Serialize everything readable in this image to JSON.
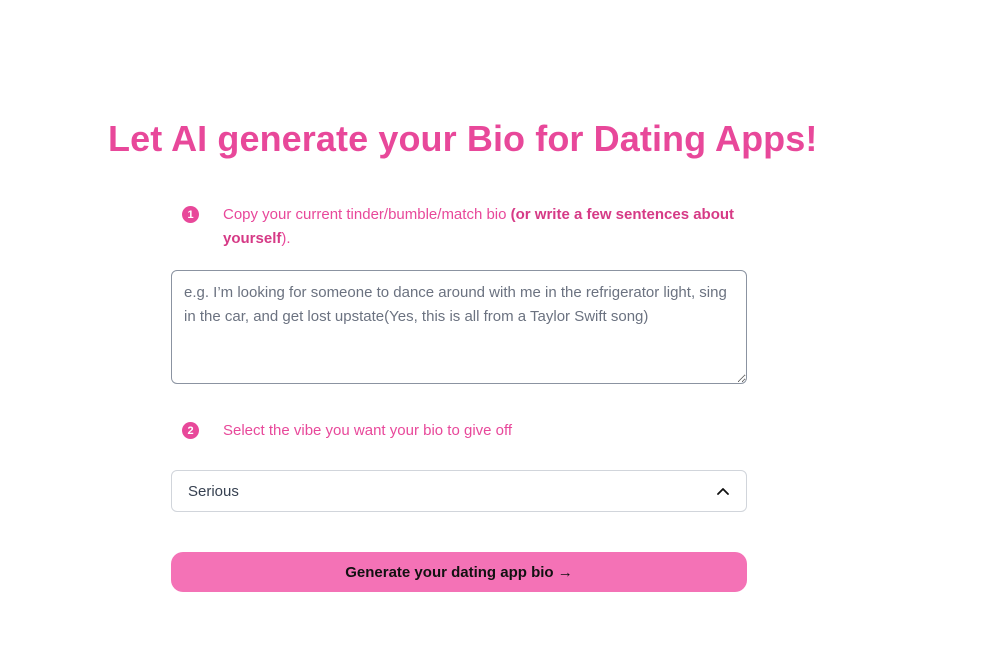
{
  "header": {
    "title": "Let AI generate your Bio for Dating Apps!"
  },
  "step1": {
    "badge": "1",
    "text_main": "Copy your current tinder/bumble/match bio ",
    "text_emph": "(or write a few sentences about yourself",
    "text_end": ")."
  },
  "bio_input": {
    "value": "",
    "placeholder": "e.g. I’m looking for someone to dance around with me in the refrigerator light, sing in the car, and get lost upstate(Yes, this is all from a Taylor Swift song)"
  },
  "step2": {
    "badge": "2",
    "text": "Select the vibe you want your bio to give off"
  },
  "vibe_select": {
    "selected": "Serious",
    "icon": "chevron-up-icon"
  },
  "generate_button": {
    "label": "Generate your dating app bio →"
  },
  "colors": {
    "accent": "#e8489a",
    "accent_dark": "#d63a86",
    "button_bg": "#f472b6",
    "textarea_border": "#8b93a1",
    "select_border": "#d1d5db"
  }
}
